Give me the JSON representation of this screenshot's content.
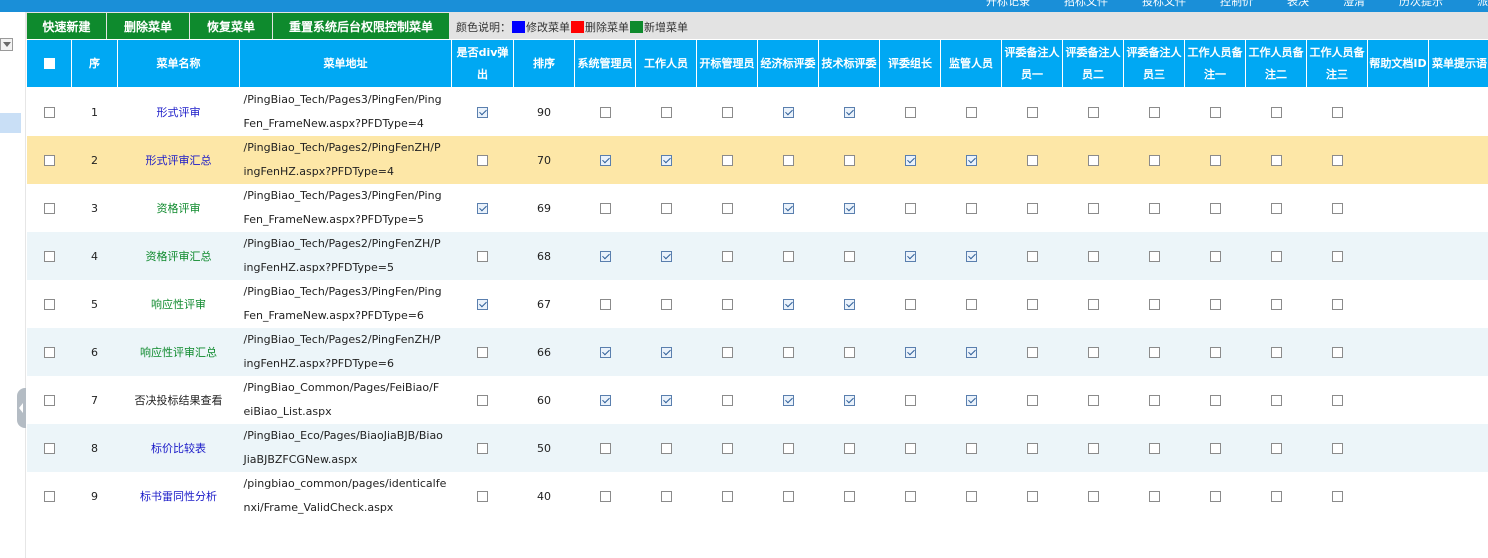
{
  "topnav": [
    "开标记录",
    "招标文件",
    "投标文件",
    "控制价",
    "表决",
    "澄清",
    "历次提示",
    "派"
  ],
  "toolbar": {
    "buttons": [
      "快速新建",
      "删除菜单",
      "恢复菜单",
      "重置系统后台权限控制菜单"
    ],
    "legend_label": "颜色说明：",
    "legend_items": [
      {
        "label": "修改菜单",
        "color": "#0000ff"
      },
      {
        "label": "删除菜单",
        "color": "#ff0000"
      },
      {
        "label": "新增菜单",
        "color": "#0e8a2d"
      }
    ]
  },
  "table": {
    "headers": [
      "序",
      "菜单名称",
      "菜单地址",
      "是否div弹出",
      "排序",
      "系统管理员",
      "工作人员",
      "开标管理员",
      "经济标评委",
      "技术标评委",
      "评委组长",
      "监管人员",
      "评委备注人员一",
      "评委备注人员二",
      "评委备注人员三",
      "工作人员备注一",
      "工作人员备注二",
      "工作人员备注三",
      "帮助文档ID",
      "菜单提示语"
    ],
    "rows": [
      {
        "no": "1",
        "name": "形式评审",
        "name_color": "blue",
        "addr1": "/PingBiao_Tech/Pages3/PingFen/Ping",
        "addr2": "Fen_FrameNew.aspx?PFDType=4",
        "div": true,
        "sort": "90",
        "roles": [
          false,
          false,
          false,
          true,
          true,
          false,
          false,
          false,
          false,
          false,
          false,
          false,
          false
        ]
      },
      {
        "no": "2",
        "name": "形式评审汇总",
        "name_color": "blue",
        "addr1": "/PingBiao_Tech/Pages2/PingFenZH/P",
        "addr2": "ingFenHZ.aspx?PFDType=4",
        "div": false,
        "sort": "70",
        "roles": [
          true,
          true,
          false,
          false,
          false,
          true,
          true,
          false,
          false,
          false,
          false,
          false,
          false
        ]
      },
      {
        "no": "3",
        "name": "资格评审",
        "name_color": "green",
        "addr1": "/PingBiao_Tech/Pages3/PingFen/Ping",
        "addr2": "Fen_FrameNew.aspx?PFDType=5",
        "div": true,
        "sort": "69",
        "roles": [
          false,
          false,
          false,
          true,
          true,
          false,
          false,
          false,
          false,
          false,
          false,
          false,
          false
        ]
      },
      {
        "no": "4",
        "name": "资格评审汇总",
        "name_color": "green",
        "addr1": "/PingBiao_Tech/Pages2/PingFenZH/P",
        "addr2": "ingFenHZ.aspx?PFDType=5",
        "div": false,
        "sort": "68",
        "roles": [
          true,
          true,
          false,
          false,
          false,
          true,
          true,
          false,
          false,
          false,
          false,
          false,
          false
        ]
      },
      {
        "no": "5",
        "name": "响应性评审",
        "name_color": "green",
        "addr1": "/PingBiao_Tech/Pages3/PingFen/Ping",
        "addr2": "Fen_FrameNew.aspx?PFDType=6",
        "div": true,
        "sort": "67",
        "roles": [
          false,
          false,
          false,
          true,
          true,
          false,
          false,
          false,
          false,
          false,
          false,
          false,
          false
        ]
      },
      {
        "no": "6",
        "name": "响应性评审汇总",
        "name_color": "green",
        "addr1": "/PingBiao_Tech/Pages2/PingFenZH/P",
        "addr2": "ingFenHZ.aspx?PFDType=6",
        "div": false,
        "sort": "66",
        "roles": [
          true,
          true,
          false,
          false,
          false,
          true,
          true,
          false,
          false,
          false,
          false,
          false,
          false
        ]
      },
      {
        "no": "7",
        "name": "否决投标结果查看",
        "name_color": "black",
        "addr1": "/PingBiao_Common/Pages/FeiBiao/F",
        "addr2": "eiBiao_List.aspx",
        "div": false,
        "sort": "60",
        "roles": [
          true,
          true,
          false,
          true,
          true,
          false,
          true,
          false,
          false,
          false,
          false,
          false,
          false
        ]
      },
      {
        "no": "8",
        "name": "标价比较表",
        "name_color": "blue",
        "addr1": "/PingBiao_Eco/Pages/BiaoJiaBJB/Biao",
        "addr2": "JiaBJBZFCGNew.aspx",
        "div": false,
        "sort": "50",
        "roles": [
          false,
          false,
          false,
          false,
          false,
          false,
          false,
          false,
          false,
          false,
          false,
          false,
          false
        ]
      },
      {
        "no": "9",
        "name": "标书雷同性分析",
        "name_color": "blue",
        "addr1": "/pingbiao_common/pages/identicalfe",
        "addr2": "nxi/Frame_ValidCheck.aspx",
        "div": false,
        "sort": "40",
        "roles": [
          false,
          false,
          false,
          false,
          false,
          false,
          false,
          false,
          false,
          false,
          false,
          false,
          false
        ]
      }
    ]
  }
}
